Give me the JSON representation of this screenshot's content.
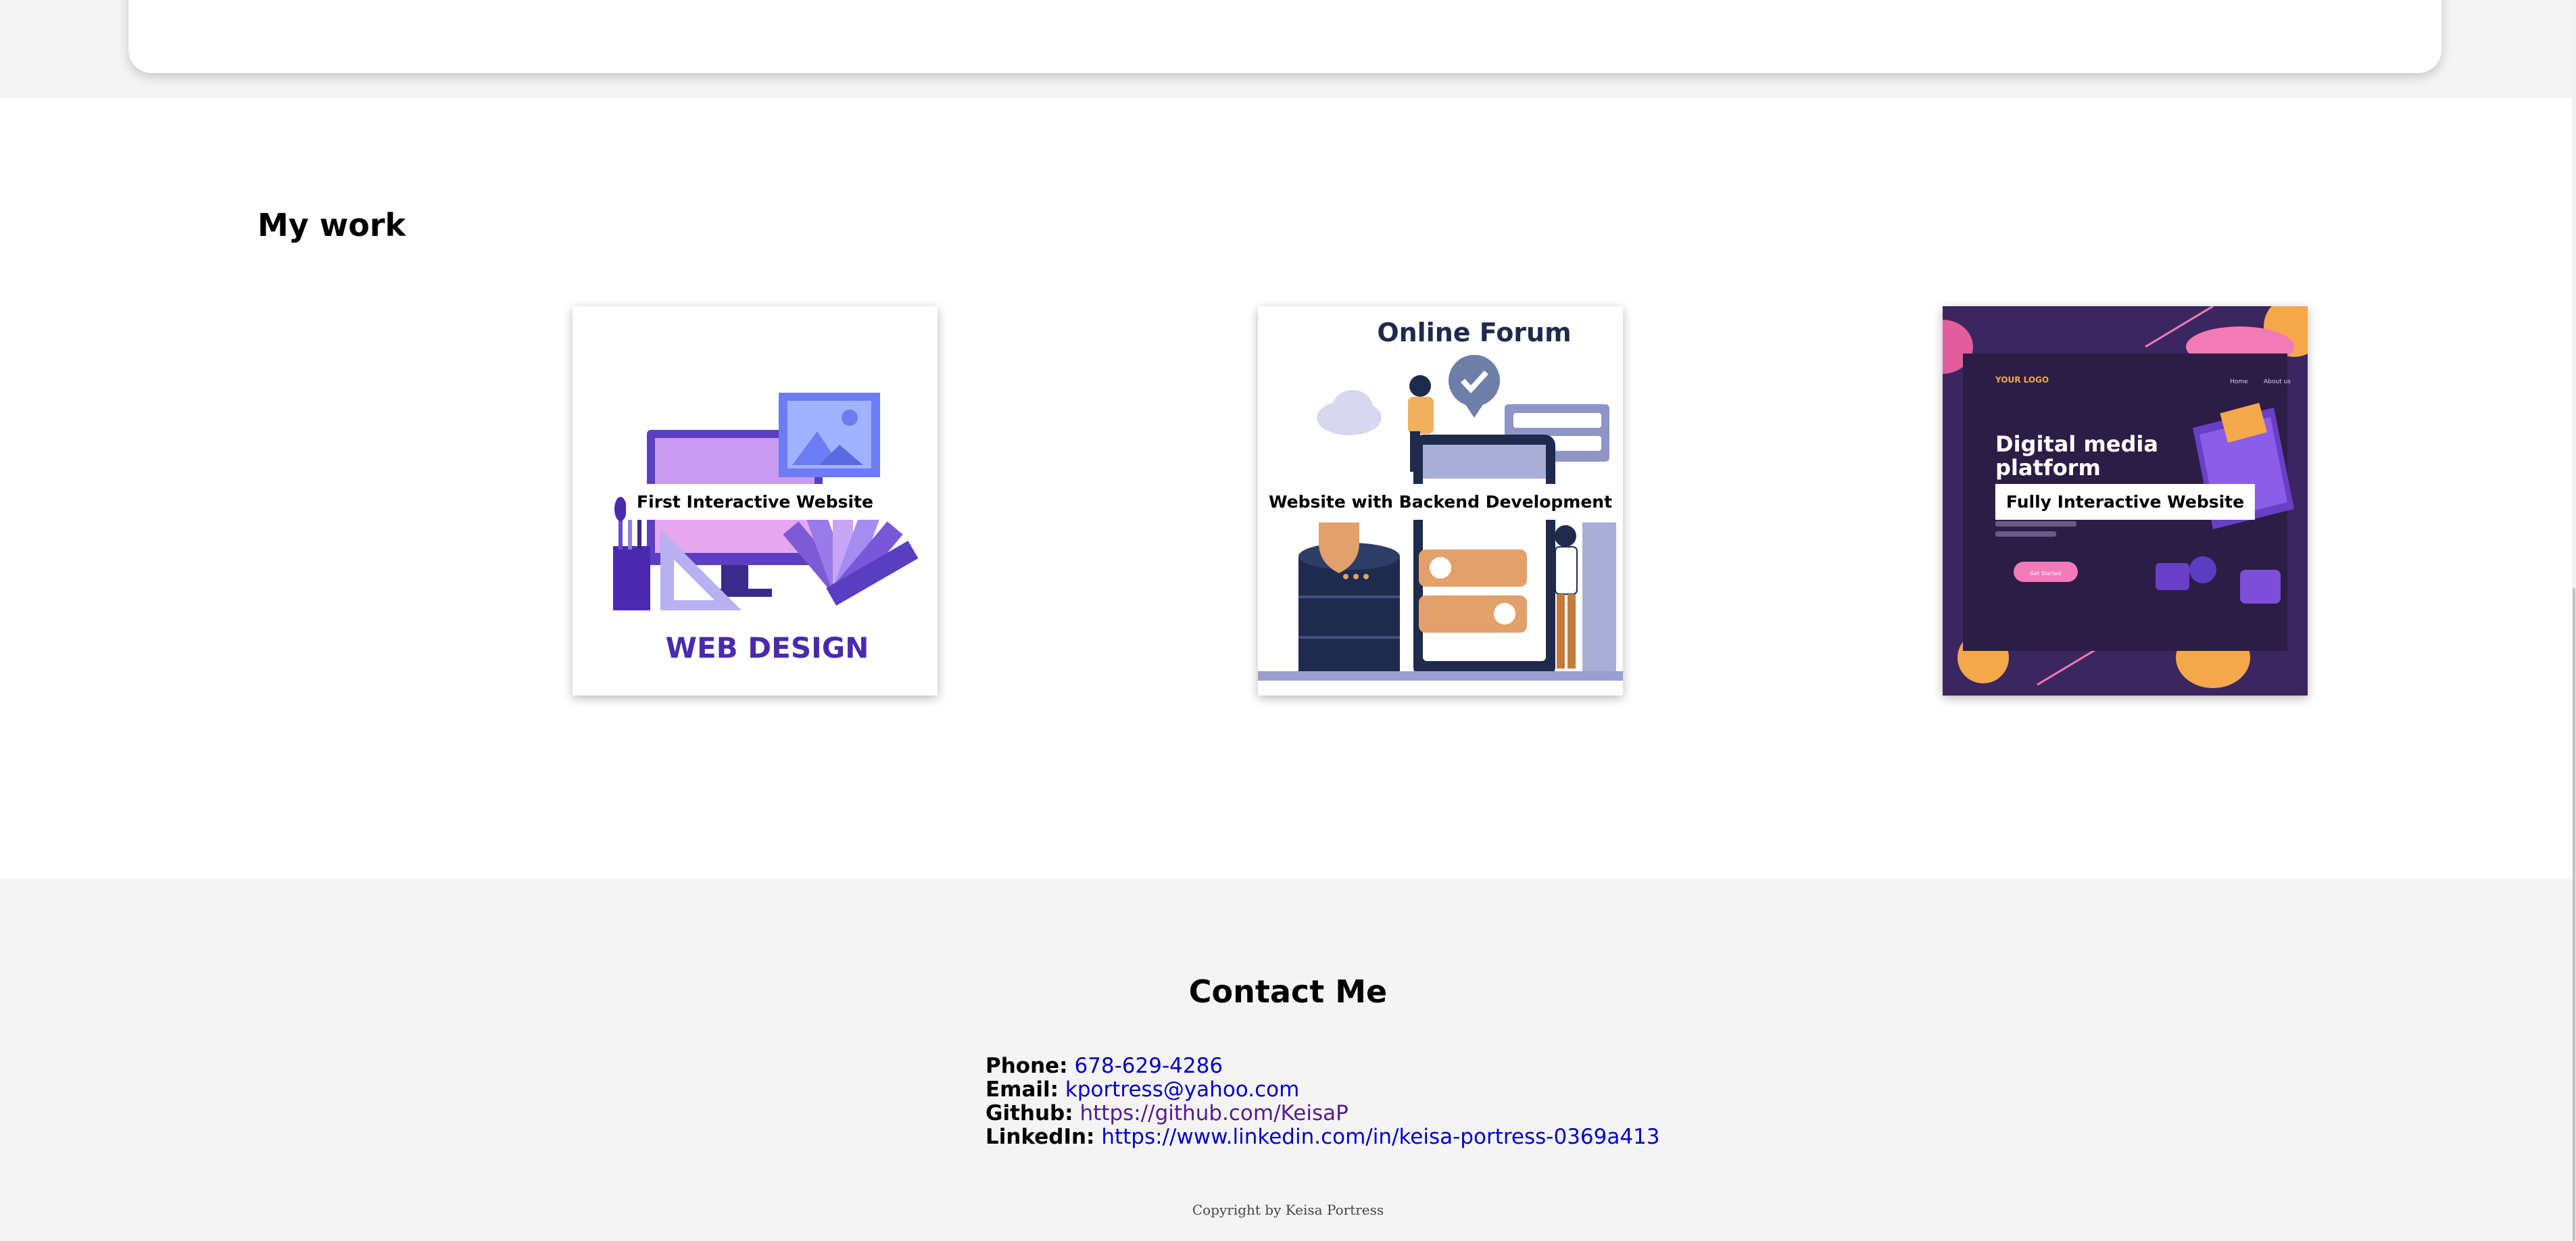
{
  "work": {
    "title": "My work",
    "projects": [
      {
        "label": "First Interactive Website",
        "image_text": "WEB DESIGN"
      },
      {
        "label": "Website with Backend Development",
        "image_text": "Online Forum"
      },
      {
        "label": "Fully Interactive Website",
        "image_logo": "YOUR LOGO",
        "image_nav_home": "Home",
        "image_nav_about": "About us",
        "image_heading_line1": "Digital media",
        "image_heading_line2": "platform",
        "image_button": "Get Started"
      }
    ]
  },
  "contact": {
    "title": "Contact Me",
    "phone_label": "Phone:",
    "phone_value": "678-629-4286",
    "email_label": "Email:",
    "email_value": "kportress@yahoo.com",
    "github_label": "Github:",
    "github_value": "https://github.com/KeisaP",
    "linkedin_label": "LinkedIn:",
    "linkedin_value": "https://www.linkedin.com/in/keisa-portress-0369a413"
  },
  "footer": {
    "copyright": "Copyright by Keisa Portress"
  },
  "colors": {
    "background": "#ffffff",
    "band": "#f4f4f4",
    "link": "#0000cc",
    "visited_link": "#551a8b",
    "web_design_purple": "#4a2bb0",
    "forum_navy": "#1f2b4d",
    "platform_dark": "#2b1d45"
  }
}
